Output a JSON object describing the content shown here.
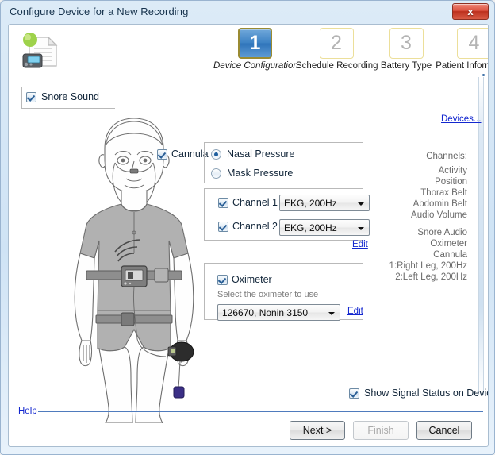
{
  "window": {
    "title": "Configure Device for a New Recording",
    "close_label": "x"
  },
  "wizard": {
    "steps": [
      {
        "number": "1",
        "label": "Device Configuration",
        "state": "active"
      },
      {
        "number": "2",
        "label": "Schedule Recording",
        "state": "inactive"
      },
      {
        "number": "3",
        "label": "Battery Type",
        "state": "inactive"
      },
      {
        "number": "4",
        "label": "Patient Information",
        "state": "inactive"
      }
    ]
  },
  "options": {
    "snore_sound": {
      "label": "Snore Sound",
      "checked": true
    },
    "cannula": {
      "label": "Cannula",
      "checked": true
    },
    "pressure_mode": {
      "nasal": {
        "label": "Nasal Pressure",
        "selected": true
      },
      "mask": {
        "label": "Mask Pressure",
        "selected": false
      }
    },
    "channel1": {
      "label": "Channel 1",
      "checked": true,
      "value": "EKG, 200Hz"
    },
    "channel2": {
      "label": "Channel 2",
      "checked": true,
      "value": "EKG, 200Hz"
    },
    "channels_edit_link": "Edit",
    "oximeter": {
      "label": "Oximeter",
      "checked": true,
      "hint": "Select the oximeter to use",
      "value": "126670, Nonin 3150",
      "edit_link": "Edit"
    },
    "show_signal_status": {
      "label": "Show Signal Status on Device",
      "checked": true
    }
  },
  "sidebar": {
    "devices_link": "Devices...",
    "channels_title": "Channels:",
    "channels_group_1": [
      "Activity",
      "Position",
      "Thorax Belt",
      "Abdomin Belt",
      "Audio Volume"
    ],
    "channels_group_2": [
      "Snore Audio",
      "Oximeter",
      "Cannula",
      "1:Right Leg, 200Hz",
      "2:Left Leg, 200Hz"
    ]
  },
  "footer": {
    "help_link": "Help",
    "next_button": "Next >",
    "finish_button": "Finish",
    "cancel_button": "Cancel"
  },
  "colors": {
    "accent": "#3d82c4",
    "link": "#1327cf",
    "active_step_border": "#9a8b32",
    "inactive_step_border": "#ecdf9a",
    "close_button": "#bc2f1d"
  }
}
